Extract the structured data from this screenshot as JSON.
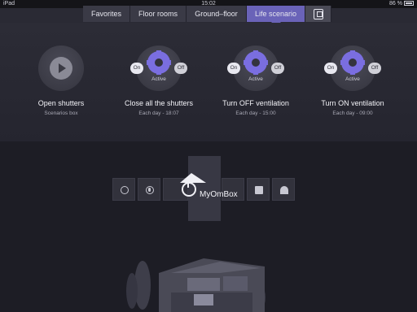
{
  "status": {
    "device": "iPad",
    "time": "15:02",
    "battery": "86 %"
  },
  "tabs": [
    "Favorites",
    "Floor rooms",
    "Ground–floor",
    "Life scenario"
  ],
  "scenarios": [
    {
      "title": "Open shutters",
      "subtitle": "Scenarios box"
    },
    {
      "title": "Close all the shutters",
      "subtitle": "Each day - 18:07",
      "on": "On",
      "off": "Off",
      "state": "Active"
    },
    {
      "title": "Turn OFF ventilation",
      "subtitle": "Each day - 15:00",
      "on": "On",
      "off": "Off",
      "state": "Active"
    },
    {
      "title": "Turn ON ventilation",
      "subtitle": "Each day - 09:00",
      "on": "On",
      "off": "Off",
      "state": "Active"
    }
  ],
  "brand": "MyOmBox",
  "colors": {
    "accent": "#6a63b8",
    "gear": "#7a6ee0"
  },
  "toolbar_icons": [
    "bulb-icon",
    "mic-icon",
    "camera-icon",
    "weather-icon"
  ]
}
